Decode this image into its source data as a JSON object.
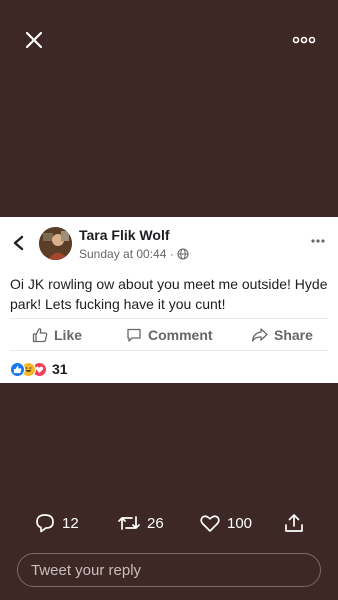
{
  "top_bar": {
    "close_icon": "close-icon",
    "more_icon": "more-horizontal-icon"
  },
  "post": {
    "author": "Tara Flik Wolf",
    "timestamp": "Sunday at 00:44 ·",
    "audience_icon": "globe-icon",
    "text": "Oi JK rowling ow about you meet me outside! Hyde park! Lets fucking have it you cunt!",
    "actions": {
      "like": "Like",
      "comment": "Comment",
      "share": "Share"
    },
    "reactions": {
      "count": "31",
      "types": [
        "like",
        "haha",
        "love"
      ]
    }
  },
  "tweet": {
    "replies": "12",
    "retweets": "26",
    "likes": "100",
    "reply_placeholder": "Tweet your reply"
  },
  "colors": {
    "background": "#3d2826",
    "card": "#ffffff",
    "like_blue": "#1877f2",
    "love_red": "#f33e58",
    "haha_yellow": "#f7b928"
  }
}
